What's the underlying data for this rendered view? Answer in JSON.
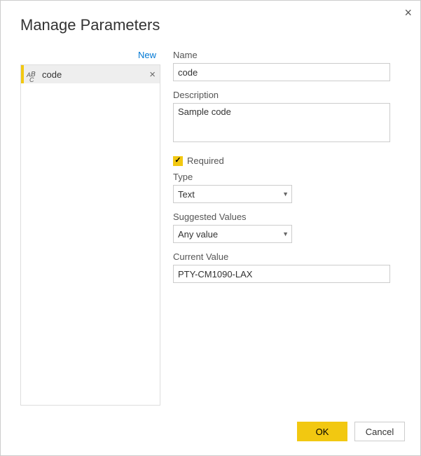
{
  "dialog": {
    "title": "Manage Parameters",
    "new_link": "New"
  },
  "param_list": {
    "items": [
      {
        "label": "code"
      }
    ]
  },
  "form": {
    "name_label": "Name",
    "name_value": "code",
    "description_label": "Description",
    "description_value": "Sample code",
    "required_label": "Required",
    "type_label": "Type",
    "type_value": "Text",
    "suggested_label": "Suggested Values",
    "suggested_value": "Any value",
    "current_label": "Current Value",
    "current_value": "PTY-CM1090-LAX"
  },
  "footer": {
    "ok": "OK",
    "cancel": "Cancel"
  }
}
